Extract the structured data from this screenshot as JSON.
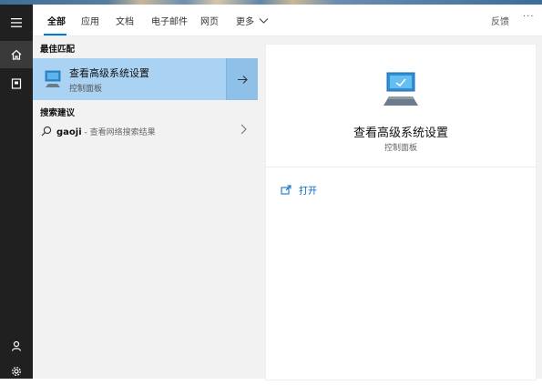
{
  "rail": {
    "items": [
      {
        "icon": "hamburger-icon"
      },
      {
        "icon": "home-icon"
      },
      {
        "icon": "notebook-icon"
      },
      {
        "icon": "user-icon"
      },
      {
        "icon": "gear-icon"
      }
    ]
  },
  "tabs": {
    "items": [
      {
        "label": "全部"
      },
      {
        "label": "应用"
      },
      {
        "label": "文档"
      },
      {
        "label": "电子邮件"
      },
      {
        "label": "网页"
      },
      {
        "label": "更多"
      }
    ],
    "feedback_label": "反馈",
    "more_options": "···"
  },
  "results": {
    "best_match_title": "最佳匹配",
    "best_match": {
      "title": "查看高级系统设置",
      "subtitle": "控制面板"
    },
    "suggestions_title": "搜索建议",
    "suggestion": {
      "query": "gaoji",
      "hint": " - 查看网络搜索结果"
    }
  },
  "preview": {
    "title": "查看高级系统设置",
    "subtitle": "控制面板",
    "open_label": "打开"
  },
  "colors": {
    "accent": "#0078d7",
    "selected_bg": "#a9d2f3",
    "rail_bg": "#202020"
  }
}
